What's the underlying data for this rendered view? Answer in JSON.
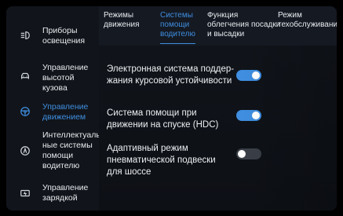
{
  "sidebar": {
    "items": [
      {
        "label": "Приборы\nосвещения",
        "icon": "headlight-icon"
      },
      {
        "label": "Управление\nвысотой\nкузова",
        "icon": "car-body-icon"
      },
      {
        "label": "Управление\nдвижением",
        "icon": "steering-wheel-icon",
        "active": true
      },
      {
        "label": "Интеллектуаль-\nные системы\nпомощи\nводителю",
        "icon": "driver-assist-icon"
      },
      {
        "label": "Управление\nзарядкой",
        "icon": "battery-icon"
      }
    ]
  },
  "tabs": [
    {
      "label": "Режимы\nдвижения"
    },
    {
      "label": "Системы\nпомощи\nводителю",
      "active": true
    },
    {
      "label": "Функция\nоблегчения посадки\nи высадки"
    },
    {
      "label": "Режим\nтехобслуживания"
    }
  ],
  "settings": [
    {
      "label": "Электронная система поддер-\nжания курсовой устойчивости",
      "state": "on"
    },
    {
      "label": "Система помощи при\nдвижении на спуске (HDC)",
      "state": "on"
    },
    {
      "label": "Адаптивный режим\nпневматической подвески\nдля шоссе",
      "state": "off"
    }
  ],
  "colors": {
    "accent": "#3f8ee0",
    "background": "#0f1217",
    "text": "#e7eaee"
  }
}
